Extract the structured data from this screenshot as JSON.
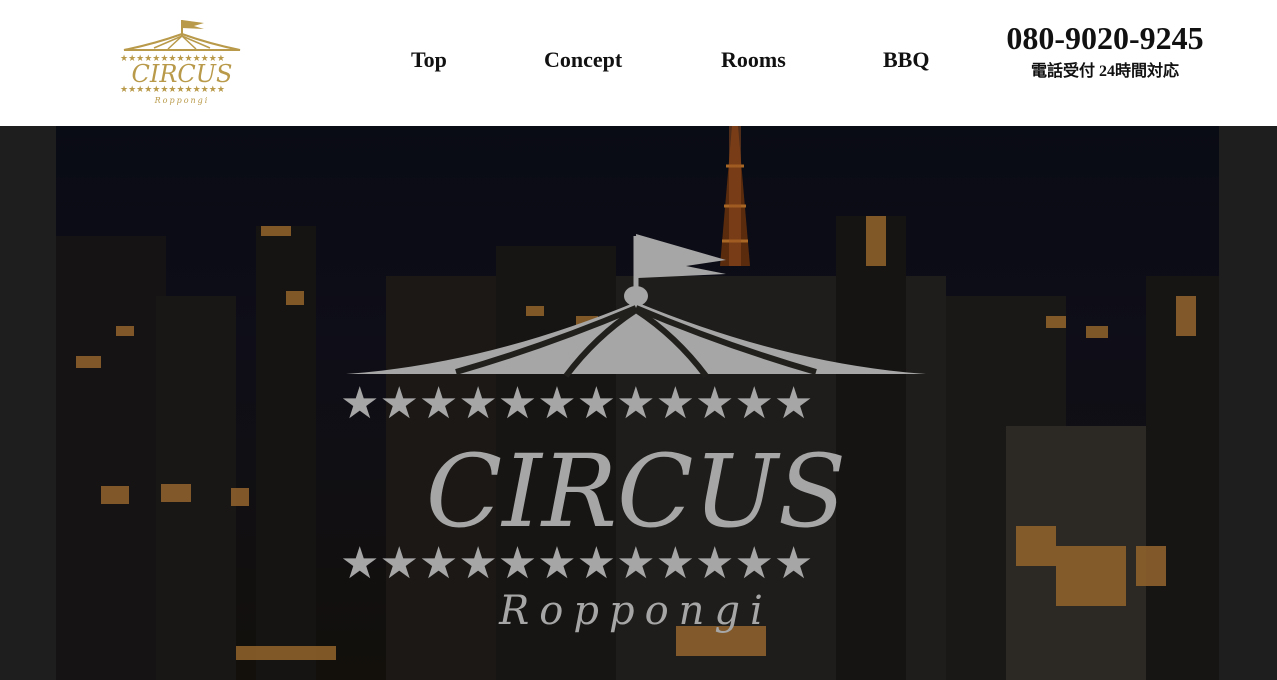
{
  "brand": {
    "name": "CIRCUS",
    "sub": "Roppongi"
  },
  "nav": {
    "items": [
      {
        "label": "Top"
      },
      {
        "label": "Concept"
      },
      {
        "label": "Rooms"
      },
      {
        "label": "BBQ"
      }
    ]
  },
  "contact": {
    "phone": "080-9020-9245",
    "hours": "電話受付 24時間対応"
  },
  "hero": {
    "logo_title": "CIRCUS",
    "logo_sub": "Roppongi"
  },
  "colors": {
    "header_bg": "#ffffff",
    "gold": "#b99a4a",
    "hero_logo": "#a6a6a6",
    "page_bg": "#1e1e1e"
  },
  "icons": {
    "tent": "circus-tent-icon",
    "star": "star-icon",
    "flag": "flag-icon"
  }
}
